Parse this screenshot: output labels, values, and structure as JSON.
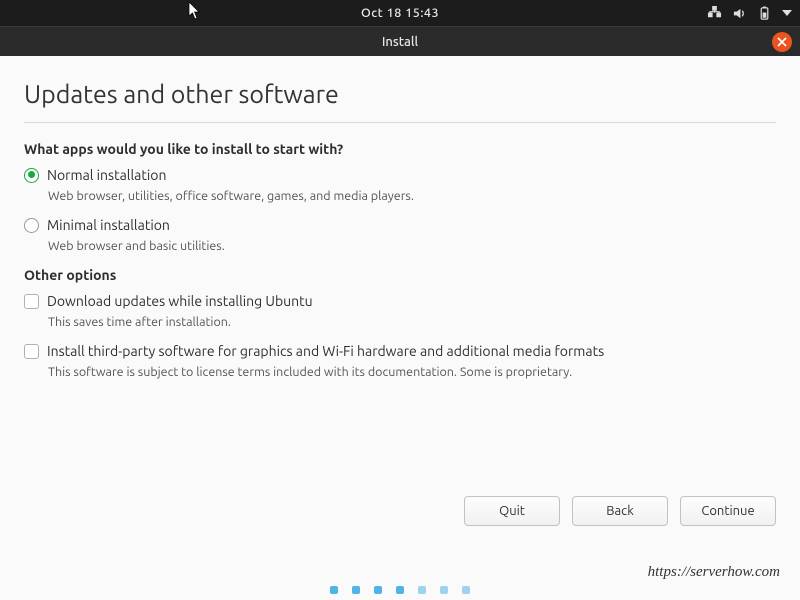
{
  "topbar": {
    "clock": "Oct 18  15:43"
  },
  "window": {
    "title": "Install"
  },
  "page": {
    "heading": "Updates and other software",
    "apps_question": "What apps would you like to install to start with?",
    "normal": {
      "label": "Normal installation",
      "desc": "Web browser, utilities, office software, games, and media players."
    },
    "minimal": {
      "label": "Minimal installation",
      "desc": "Web browser and basic utilities."
    },
    "other_heading": "Other options",
    "download_updates": {
      "label": "Download updates while installing Ubuntu",
      "desc": "This saves time after installation."
    },
    "third_party": {
      "label": "Install third-party software for graphics and Wi-Fi hardware and additional media formats",
      "desc": "This software is subject to license terms included with its documentation. Some is proprietary."
    }
  },
  "buttons": {
    "quit": "Quit",
    "back": "Back",
    "continue": "Continue"
  },
  "watermark": "https://serverhow.com"
}
